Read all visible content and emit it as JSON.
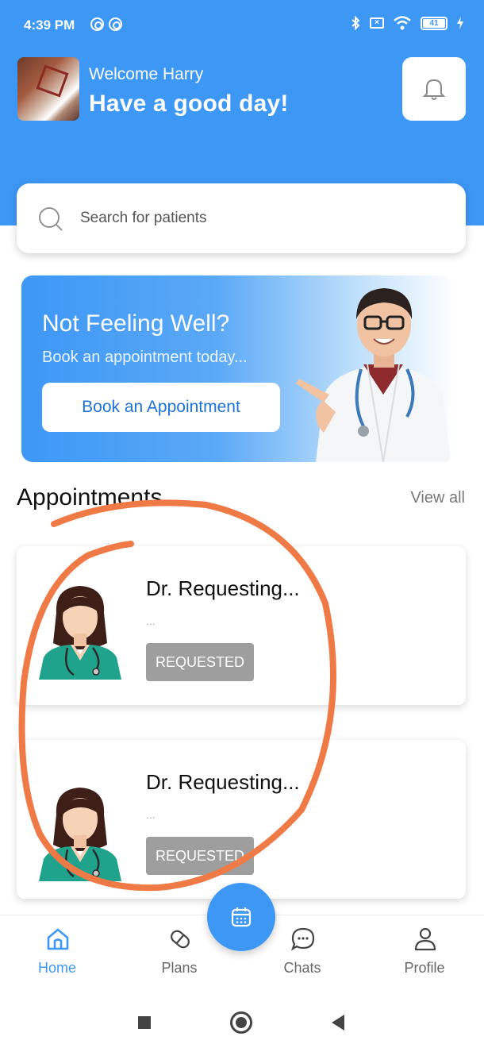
{
  "status_bar": {
    "time": "4:39 PM",
    "battery": "41"
  },
  "header": {
    "welcome": "Welcome Harry",
    "greeting": "Have a good day!",
    "bell_icon": "bell-icon"
  },
  "search": {
    "placeholder": "Search for patients",
    "icon": "search-icon"
  },
  "banner": {
    "title": "Not Feeling Well?",
    "subtitle": "Book an appointment today...",
    "button_label": "Book an Appointment"
  },
  "appointments": {
    "title": "Appointments",
    "view_all": "View all",
    "items": [
      {
        "name": "Dr. Requesting...",
        "sub": "...",
        "status": "REQUESTED"
      },
      {
        "name": "Dr. Requesting...",
        "sub": "...",
        "status": "REQUESTED"
      }
    ]
  },
  "nav": {
    "items": [
      {
        "label": "Home",
        "icon": "home-icon",
        "active": true
      },
      {
        "label": "Plans",
        "icon": "pill-icon",
        "active": false
      },
      {
        "label": "Chats",
        "icon": "chat-icon",
        "active": false
      },
      {
        "label": "Profile",
        "icon": "person-icon",
        "active": false
      }
    ],
    "fab_icon": "calendar-icon"
  },
  "colors": {
    "primary": "#3d97f5",
    "annotation": "#f07a45",
    "badge": "#9e9e9e"
  }
}
